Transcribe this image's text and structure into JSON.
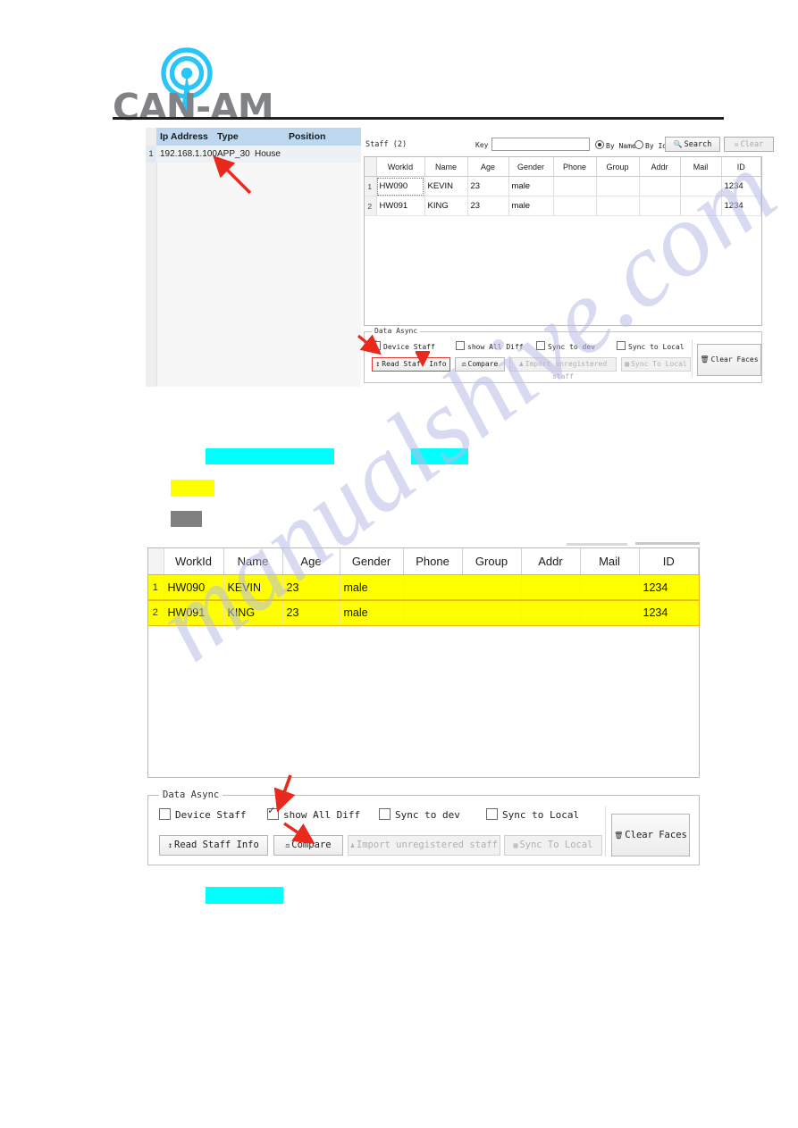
{
  "logo": {
    "wordmark": "CAN-AM",
    "mark_icon": "antenna-signal-icon",
    "mark_color": "#29c5f6",
    "word_color": "#808285"
  },
  "watermark": {
    "text": "manualshive.com"
  },
  "top_screenshot": {
    "device_table": {
      "columns": [
        "Ip Address",
        "Type",
        "Position"
      ],
      "header_bg": "#bdd7ee",
      "rows": [
        {
          "num": "1",
          "ip": "192.168.1.100",
          "type": "APP_30",
          "position": "House"
        }
      ]
    },
    "staff": {
      "count_label": "Staff (2)",
      "key_label": "Key",
      "key_value": "",
      "radio_by_name": "By Name",
      "radio_by_id": "By Id",
      "radio_selected": "By Name",
      "search_button": "Search",
      "search_icon": "magnifier-icon",
      "clear_button": "Clear",
      "clear_icon": "clear-icon",
      "clear_disabled": true
    },
    "table": {
      "columns": [
        "WorkId",
        "Name",
        "Age",
        "Gender",
        "Phone",
        "Group",
        "Addr",
        "Mail",
        "ID"
      ],
      "rows": [
        {
          "num": "1",
          "workid": "HW090",
          "name": "KEVIN",
          "age": "23",
          "gender": "male",
          "phone": "",
          "group": "",
          "addr": "",
          "mail": "",
          "id": "1234"
        },
        {
          "num": "2",
          "workid": "HW091",
          "name": "KING",
          "age": "23",
          "gender": "male",
          "phone": "",
          "group": "",
          "addr": "",
          "mail": "",
          "id": "1234"
        }
      ]
    },
    "data_async": {
      "legend": "Data Async",
      "checkboxes": [
        {
          "label": "Device Staff",
          "checked": true
        },
        {
          "label": "show All Diff",
          "checked": false
        },
        {
          "label": "Sync to dev",
          "checked": false
        },
        {
          "label": "Sync to Local",
          "checked": false
        }
      ],
      "buttons": [
        {
          "label": "Read Staff  Info",
          "icon": "download-icon",
          "disabled": false,
          "highlighted": true
        },
        {
          "label": "Compare",
          "icon": "compare-icon",
          "disabled": false,
          "highlighted": false
        },
        {
          "label": "Import unregistered staff",
          "icon": "person-add-icon",
          "disabled": true,
          "highlighted": false
        },
        {
          "label": "Sync To Local",
          "icon": "database-icon",
          "disabled": true,
          "highlighted": false
        }
      ],
      "clear_faces": {
        "label": "Clear Faces",
        "icon": "broom-icon"
      }
    }
  },
  "bottom_screenshot": {
    "table": {
      "columns": [
        "WorkId",
        "Name",
        "Age",
        "Gender",
        "Phone",
        "Group",
        "Addr",
        "Mail",
        "ID"
      ],
      "highlight_color": "#ffff00",
      "rows": [
        {
          "num": "1",
          "workid": "HW090",
          "name": "KEVIN",
          "age": "23",
          "gender": "male",
          "phone": "",
          "group": "",
          "addr": "",
          "mail": "",
          "id": "1234"
        },
        {
          "num": "2",
          "workid": "HW091",
          "name": "KING",
          "age": "23",
          "gender": "male",
          "phone": "",
          "group": "",
          "addr": "",
          "mail": "",
          "id": "1234"
        }
      ]
    },
    "data_async": {
      "legend": "Data Async",
      "checkboxes": [
        {
          "label": "Device Staff",
          "checked": false
        },
        {
          "label": "show All Diff",
          "checked": true
        },
        {
          "label": "Sync to dev",
          "checked": false
        },
        {
          "label": "Sync to Local",
          "checked": false
        }
      ],
      "buttons": [
        {
          "label": "Read Staff  Info",
          "icon": "download-icon",
          "disabled": false,
          "highlighted": false
        },
        {
          "label": "Compare",
          "icon": "compare-icon",
          "disabled": false,
          "highlighted": false
        },
        {
          "label": "Import unregistered staff",
          "icon": "person-add-icon",
          "disabled": true,
          "highlighted": false
        },
        {
          "label": "Sync To Local",
          "icon": "database-icon",
          "disabled": true,
          "highlighted": false
        }
      ],
      "clear_faces": {
        "label": "Clear Faces",
        "icon": "broom-icon"
      }
    }
  },
  "annotations": {
    "highlight_bars": [
      {
        "name": "redacted-cyan-bar-1",
        "color": "#00ffff"
      },
      {
        "name": "redacted-cyan-bar-2",
        "color": "#00ffff"
      },
      {
        "name": "redacted-yellow-bar",
        "color": "#ffff00"
      },
      {
        "name": "redacted-gray-bar",
        "color": "#808080"
      },
      {
        "name": "redacted-cyan-bar-3",
        "color": "#00ffff"
      }
    ],
    "arrow_color": "#e8291c"
  }
}
